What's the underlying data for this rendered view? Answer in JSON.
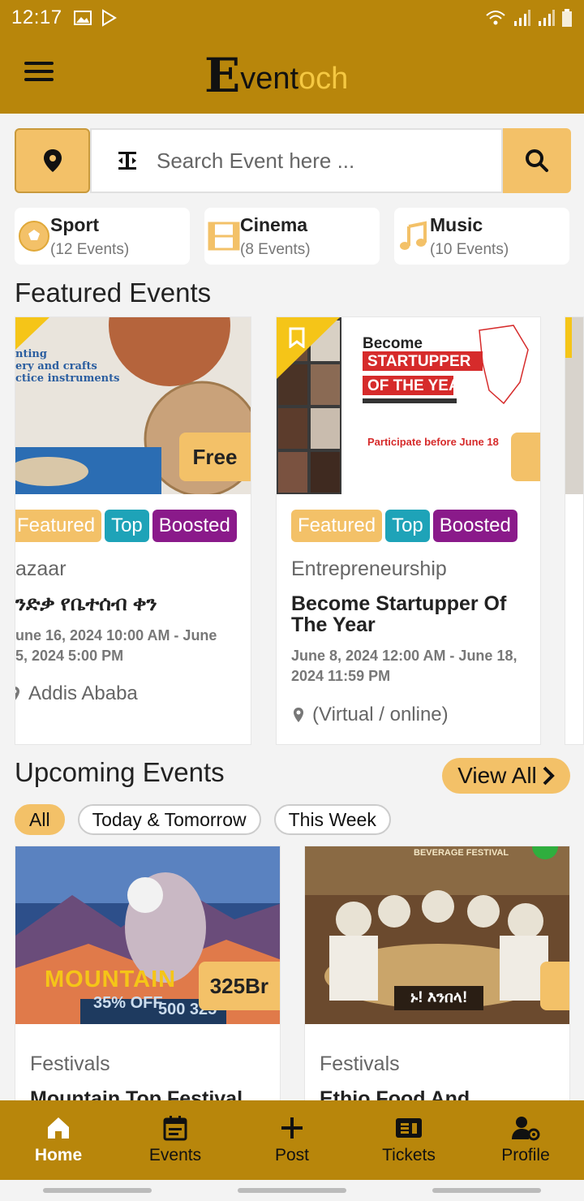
{
  "status_bar": {
    "time": "12:17"
  },
  "app": {
    "logo_mark": "E",
    "logo_text_dark": "vent",
    "logo_text_light": "och"
  },
  "search": {
    "placeholder": "Search Event here ..."
  },
  "categories": [
    {
      "name": "Sport",
      "count": "(12 Events)",
      "icon": "soccer-ball-icon"
    },
    {
      "name": "Cinema",
      "count": "(8 Events)",
      "icon": "film-icon"
    },
    {
      "name": "Music",
      "count": "(10 Events)",
      "icon": "music-note-icon"
    }
  ],
  "featured": {
    "title": "Featured Events",
    "cards": [
      {
        "badges": [
          "Featured",
          "Top",
          "Boosted"
        ],
        "category": "azaar",
        "title": "ንድቃ የቤተሰብ ቀን",
        "date": "une 16, 2024 10:00 AM - June\n5, 2024 5:00 PM",
        "location": "Addis Ababa",
        "price": "Free",
        "image_lines": [
          "nting",
          "ery and crafts",
          "ctice instruments"
        ]
      },
      {
        "badges": [
          "Featured",
          "Top",
          "Boosted"
        ],
        "category": "Entrepreneurship",
        "title": "Become Startupper Of The Year",
        "date": "June 8, 2024 12:00 AM - June 18,\n2024 11:59 PM",
        "location": "(Virtual / online)",
        "image_lines": [
          "Become",
          "STARTUPPER",
          "OF THE YEAR",
          "Participate before June 18"
        ]
      }
    ]
  },
  "upcoming": {
    "title": "Upcoming Events",
    "view_all": "View All",
    "filters": [
      "All",
      "Today & Tomorrow",
      "This Week"
    ],
    "active_filter": "All",
    "cards": [
      {
        "category": "Festivals",
        "title": "Mountain Top Festival",
        "price": "325Br",
        "image_text": "MOUNTAIN",
        "image_discount": "35% OFF",
        "image_prices": "500 325"
      },
      {
        "category": "Festivals",
        "title": "Ethio Food And",
        "image_text": "ኑ! እንበላ!",
        "image_header": "BEVERAGE FESTIVAL"
      }
    ]
  },
  "bottom_nav": [
    {
      "label": "Home",
      "icon": "home-icon",
      "active": true
    },
    {
      "label": "Events",
      "icon": "calendar-icon",
      "active": false
    },
    {
      "label": "Post",
      "icon": "plus-icon",
      "active": false
    },
    {
      "label": "Tickets",
      "icon": "ticket-icon",
      "active": false
    },
    {
      "label": "Profile",
      "icon": "user-settings-icon",
      "active": false
    }
  ],
  "colors": {
    "primary": "#b8860b",
    "accent": "#f3c168",
    "top_badge": "#1ea3b8",
    "boosted_badge": "#8a1a8a"
  }
}
